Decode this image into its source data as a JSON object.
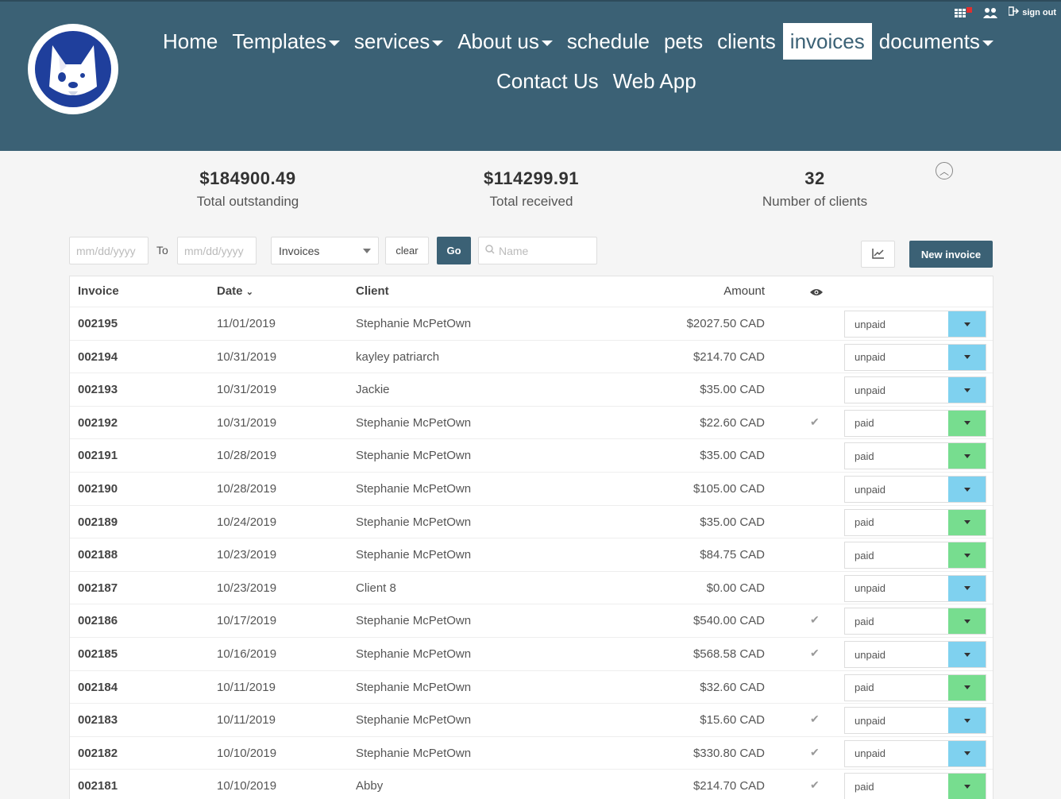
{
  "header": {
    "nav_row1": [
      {
        "label": "Home",
        "dropdown": false,
        "active": false
      },
      {
        "label": "Templates",
        "dropdown": true,
        "active": false
      },
      {
        "label": "services",
        "dropdown": true,
        "active": false
      },
      {
        "label": "About us",
        "dropdown": true,
        "active": false
      },
      {
        "label": "schedule",
        "dropdown": false,
        "active": false
      },
      {
        "label": "pets",
        "dropdown": false,
        "active": false
      },
      {
        "label": "clients",
        "dropdown": false,
        "active": false
      },
      {
        "label": "invoices",
        "dropdown": false,
        "active": true
      },
      {
        "label": "documents",
        "dropdown": true,
        "active": false
      }
    ],
    "nav_row2": [
      {
        "label": "Contact Us"
      },
      {
        "label": "Web App"
      }
    ],
    "sign_out_label": "sign out"
  },
  "summary": {
    "outstanding_value": "$184900.49",
    "outstanding_label": "Total outstanding",
    "received_value": "$114299.91",
    "received_label": "Total received",
    "clients_value": "32",
    "clients_label": "Number of clients"
  },
  "filters": {
    "from_placeholder": "mm/dd/yyyy",
    "to_label": "To",
    "to_placeholder": "mm/dd/yyyy",
    "type_selected": "Invoices",
    "clear_label": "clear",
    "go_label": "Go",
    "name_placeholder": "Name",
    "new_invoice_label": "New invoice"
  },
  "table": {
    "headers": {
      "invoice": "Invoice",
      "date": "Date",
      "client": "Client",
      "amount": "Amount"
    },
    "rows": [
      {
        "invoice": "002195",
        "date": "11/01/2019",
        "client": "Stephanie McPetOwn",
        "amount": "$2027.50 CAD",
        "viewed": false,
        "status": "unpaid"
      },
      {
        "invoice": "002194",
        "date": "10/31/2019",
        "client": "kayley patriarch",
        "amount": "$214.70 CAD",
        "viewed": false,
        "status": "unpaid"
      },
      {
        "invoice": "002193",
        "date": "10/31/2019",
        "client": "Jackie",
        "amount": "$35.00 CAD",
        "viewed": false,
        "status": "unpaid"
      },
      {
        "invoice": "002192",
        "date": "10/31/2019",
        "client": "Stephanie McPetOwn",
        "amount": "$22.60 CAD",
        "viewed": true,
        "status": "paid"
      },
      {
        "invoice": "002191",
        "date": "10/28/2019",
        "client": "Stephanie McPetOwn",
        "amount": "$35.00 CAD",
        "viewed": false,
        "status": "paid"
      },
      {
        "invoice": "002190",
        "date": "10/28/2019",
        "client": "Stephanie McPetOwn",
        "amount": "$105.00 CAD",
        "viewed": false,
        "status": "unpaid"
      },
      {
        "invoice": "002189",
        "date": "10/24/2019",
        "client": "Stephanie McPetOwn",
        "amount": "$35.00 CAD",
        "viewed": false,
        "status": "paid"
      },
      {
        "invoice": "002188",
        "date": "10/23/2019",
        "client": "Stephanie McPetOwn",
        "amount": "$84.75 CAD",
        "viewed": false,
        "status": "paid"
      },
      {
        "invoice": "002187",
        "date": "10/23/2019",
        "client": "Client 8",
        "amount": "$0.00 CAD",
        "viewed": false,
        "status": "unpaid"
      },
      {
        "invoice": "002186",
        "date": "10/17/2019",
        "client": "Stephanie McPetOwn",
        "amount": "$540.00 CAD",
        "viewed": true,
        "status": "paid"
      },
      {
        "invoice": "002185",
        "date": "10/16/2019",
        "client": "Stephanie McPetOwn",
        "amount": "$568.58 CAD",
        "viewed": true,
        "status": "unpaid"
      },
      {
        "invoice": "002184",
        "date": "10/11/2019",
        "client": "Stephanie McPetOwn",
        "amount": "$32.60 CAD",
        "viewed": false,
        "status": "paid"
      },
      {
        "invoice": "002183",
        "date": "10/11/2019",
        "client": "Stephanie McPetOwn",
        "amount": "$15.60 CAD",
        "viewed": true,
        "status": "unpaid"
      },
      {
        "invoice": "002182",
        "date": "10/10/2019",
        "client": "Stephanie McPetOwn",
        "amount": "$330.80 CAD",
        "viewed": true,
        "status": "unpaid"
      },
      {
        "invoice": "002181",
        "date": "10/10/2019",
        "client": "Abby",
        "amount": "$214.70 CAD",
        "viewed": true,
        "status": "paid"
      }
    ]
  },
  "colors": {
    "header_bg": "#3b6175",
    "unpaid_toggle": "#7fd1ef",
    "paid_toggle": "#77dd8f"
  }
}
